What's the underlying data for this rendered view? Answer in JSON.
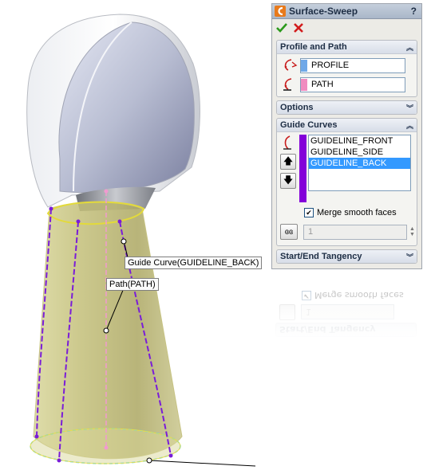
{
  "viewport": {
    "callouts": {
      "guide_curve": "Guide Curve(GUIDELINE_BACK)",
      "path": "Path(PATH)"
    }
  },
  "property_manager": {
    "title": "Surface-Sweep",
    "help_label": "?",
    "ok_icon": "checkmark-icon",
    "cancel_icon": "x-icon",
    "profile_and_path": {
      "header": "Profile and Path",
      "profile_value": "PROFILE",
      "path_value": "PATH",
      "profile_color": "#6fa8e8",
      "path_color": "#f08cc0"
    },
    "options": {
      "header": "Options"
    },
    "guide_curves": {
      "header": "Guide Curves",
      "items": [
        "GUIDELINE_FRONT",
        "GUIDELINE_SIDE",
        "GUIDELINE_BACK"
      ],
      "selected_item": "GUIDELINE_BACK",
      "list_color": "#8300d9",
      "merge_smooth_faces_label": "Merge smooth faces",
      "merge_smooth_faces_checked": true,
      "sections_value": "1"
    },
    "start_end_tangency": {
      "header": "Start/End Tangency"
    }
  }
}
